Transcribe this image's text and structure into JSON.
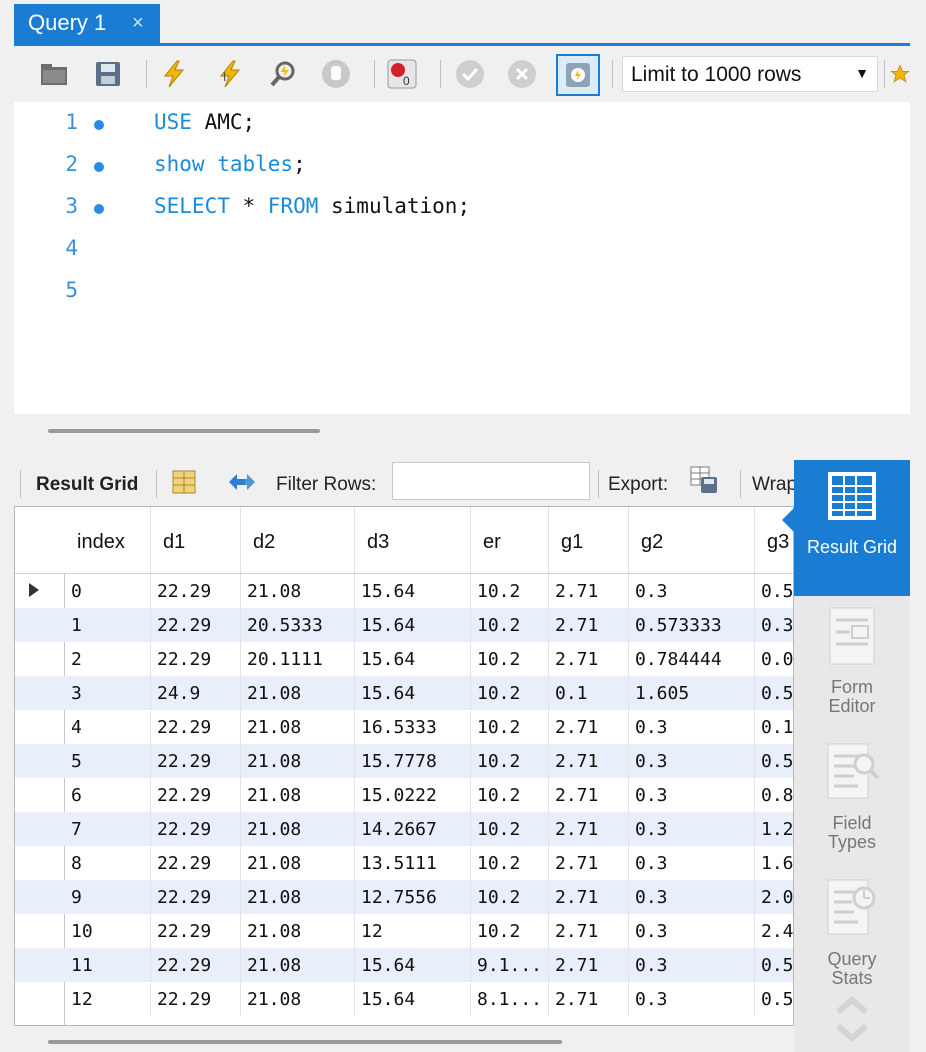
{
  "tab": {
    "title": "Query 1",
    "close": "×"
  },
  "toolbar": {
    "limit_value": "Limit to 1000 rows",
    "icons": [
      "folder-open-icon",
      "save-icon",
      "execute-icon",
      "execute-current-icon",
      "explain-icon",
      "stop-icon",
      "toggle-error-icon",
      "commit-icon",
      "rollback-icon",
      "autocommit-icon",
      "bookmark-icon"
    ]
  },
  "editor": {
    "lines": [
      {
        "n": "1",
        "dot": true,
        "kw1": "USE",
        "rest": " AMC;"
      },
      {
        "n": "2",
        "dot": true,
        "kw1": "show tables",
        "rest": ";"
      },
      {
        "n": "3",
        "dot": true,
        "kw1": "SELECT",
        "mid": " * ",
        "kw2": "FROM",
        "rest": " simulation;"
      },
      {
        "n": "4",
        "dot": false
      },
      {
        "n": "5",
        "dot": false
      }
    ]
  },
  "result_toolbar": {
    "result_grid_label": "Result Grid",
    "filter_label": "Filter Rows:",
    "filter_value": "",
    "export_label": "Export:",
    "wrap_label": "Wrap"
  },
  "grid": {
    "columns": [
      "index",
      "d1",
      "d2",
      "d3",
      "er",
      "g1",
      "g2",
      "g3"
    ],
    "rows": [
      [
        "0",
        "22.29",
        "21.08",
        "15.64",
        "10.2",
        "2.71",
        "0.3",
        "0.5"
      ],
      [
        "1",
        "22.29",
        "20.5333",
        "15.64",
        "10.2",
        "2.71",
        "0.573333",
        "0.3"
      ],
      [
        "2",
        "22.29",
        "20.1111",
        "15.64",
        "10.2",
        "2.71",
        "0.784444",
        "0.0"
      ],
      [
        "3",
        "24.9",
        "21.08",
        "15.64",
        "10.2",
        "0.1",
        "1.605",
        "0.5"
      ],
      [
        "4",
        "22.29",
        "21.08",
        "16.5333",
        "10.2",
        "2.71",
        "0.3",
        "0.1"
      ],
      [
        "5",
        "22.29",
        "21.08",
        "15.7778",
        "10.2",
        "2.71",
        "0.3",
        "0.5"
      ],
      [
        "6",
        "22.29",
        "21.08",
        "15.0222",
        "10.2",
        "2.71",
        "0.3",
        "0.8"
      ],
      [
        "7",
        "22.29",
        "21.08",
        "14.2667",
        "10.2",
        "2.71",
        "0.3",
        "1.2"
      ],
      [
        "8",
        "22.29",
        "21.08",
        "13.5111",
        "10.2",
        "2.71",
        "0.3",
        "1.6"
      ],
      [
        "9",
        "22.29",
        "21.08",
        "12.7556",
        "10.2",
        "2.71",
        "0.3",
        "2.0"
      ],
      [
        "10",
        "22.29",
        "21.08",
        "12",
        "10.2",
        "2.71",
        "0.3",
        "2.4"
      ],
      [
        "11",
        "22.29",
        "21.08",
        "15.64",
        "9.1...",
        "2.71",
        "0.3",
        "0.5"
      ],
      [
        "12",
        "22.29",
        "21.08",
        "15.64",
        "8.1...",
        "2.71",
        "0.3",
        "0.5"
      ]
    ]
  },
  "side_panel": {
    "result_grid": "Result Grid",
    "form_editor": "Form Editor",
    "field_types": "Field Types",
    "query_stats": "Query Stats"
  },
  "colors": {
    "accent": "#1a7dd3",
    "alt_row": "#e8effa",
    "keyword": "#1a8bd8"
  }
}
